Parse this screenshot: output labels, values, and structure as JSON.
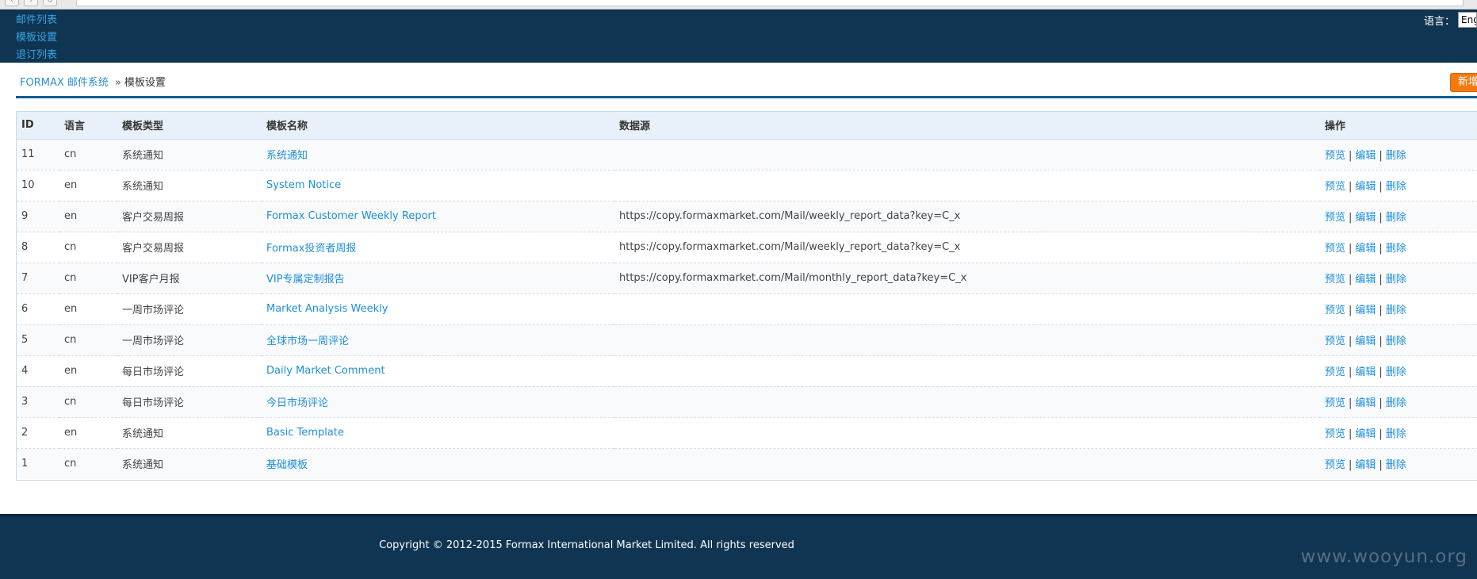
{
  "top_nav": {
    "items": [
      "邮件列表",
      "模板设置",
      "退订列表"
    ]
  },
  "language": {
    "label": "语言：",
    "selected": "Eng"
  },
  "breadcrumb": {
    "home": "FORMAX 邮件系统",
    "separator": "»",
    "current": "模板设置"
  },
  "toolbar": {
    "new_label": "新增"
  },
  "table": {
    "headers": [
      "ID",
      "语言",
      "模板类型",
      "模板名称",
      "数据源",
      "操作"
    ],
    "actions": [
      "预览",
      "编辑",
      "删除"
    ],
    "action_separator": "|",
    "rows": [
      {
        "id": "11",
        "lang": "cn",
        "type": "系统通知",
        "name": "系统通知",
        "source": ""
      },
      {
        "id": "10",
        "lang": "en",
        "type": "系统通知",
        "name": "System Notice",
        "source": ""
      },
      {
        "id": "9",
        "lang": "en",
        "type": "客户交易周报",
        "name": "Formax Customer Weekly Report",
        "source": "https://copy.formaxmarket.com/Mail/weekly_report_data?key=C_x"
      },
      {
        "id": "8",
        "lang": "cn",
        "type": "客户交易周报",
        "name": "Formax投资者周报",
        "source": "https://copy.formaxmarket.com/Mail/weekly_report_data?key=C_x"
      },
      {
        "id": "7",
        "lang": "cn",
        "type": "VIP客户月报",
        "name": "VIP专属定制报告",
        "source": "https://copy.formaxmarket.com/Mail/monthly_report_data?key=C_x"
      },
      {
        "id": "6",
        "lang": "en",
        "type": "一周市场评论",
        "name": "Market Analysis Weekly",
        "source": ""
      },
      {
        "id": "5",
        "lang": "cn",
        "type": "一周市场评论",
        "name": "全球市场一周评论",
        "source": ""
      },
      {
        "id": "4",
        "lang": "en",
        "type": "每日市场评论",
        "name": "Daily Market Comment",
        "source": ""
      },
      {
        "id": "3",
        "lang": "cn",
        "type": "每日市场评论",
        "name": "今日市场评论",
        "source": ""
      },
      {
        "id": "2",
        "lang": "en",
        "type": "系统通知",
        "name": "Basic Template",
        "source": ""
      },
      {
        "id": "1",
        "lang": "cn",
        "type": "系统通知",
        "name": "基础模板",
        "source": ""
      }
    ]
  },
  "footer": {
    "copyright": "Copyright © 2012-2015 Formax International Market Limited. All rights reserved",
    "watermark": "www.wooyun.org"
  },
  "colors": {
    "header_bg": "#0f3552",
    "link": "#1f8fd8",
    "accent_button": "#f47a10",
    "divider": "#0f5d95"
  }
}
